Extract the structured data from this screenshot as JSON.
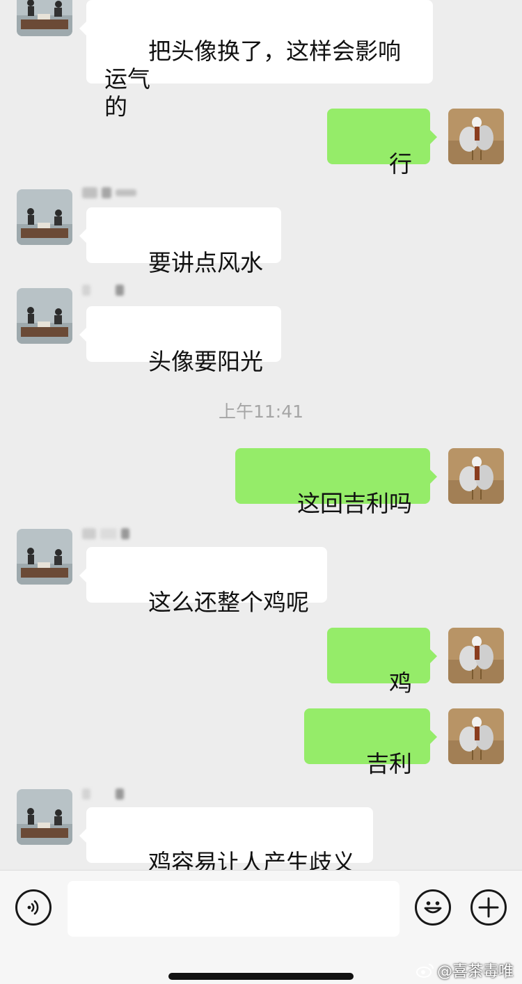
{
  "messages": [
    {
      "side": "in",
      "text": "把头像换了，这样会影响运气\n的"
    },
    {
      "side": "out",
      "text": "行"
    },
    {
      "side": "in",
      "text": "要讲点风水"
    },
    {
      "side": "in",
      "text": "头像要阳光"
    },
    {
      "side": "out",
      "text": "这回吉利吗"
    },
    {
      "side": "in",
      "text": "这么还整个鸡呢"
    },
    {
      "side": "out",
      "text": "鸡"
    },
    {
      "side": "out",
      "text": "吉利"
    },
    {
      "side": "in",
      "text": "鸡容易让人产生歧义"
    }
  ],
  "timestamp": "上午11:41",
  "input": {
    "value": "",
    "placeholder": ""
  },
  "icons": {
    "voice": "voice-icon",
    "emoji": "emoji-icon",
    "plus": "plus-icon"
  },
  "watermark": "@喜茶毒唯",
  "colors": {
    "background": "#ededed",
    "bubble_out": "#95ec69",
    "bubble_in": "#ffffff",
    "timestamp": "#a5a5a5"
  }
}
